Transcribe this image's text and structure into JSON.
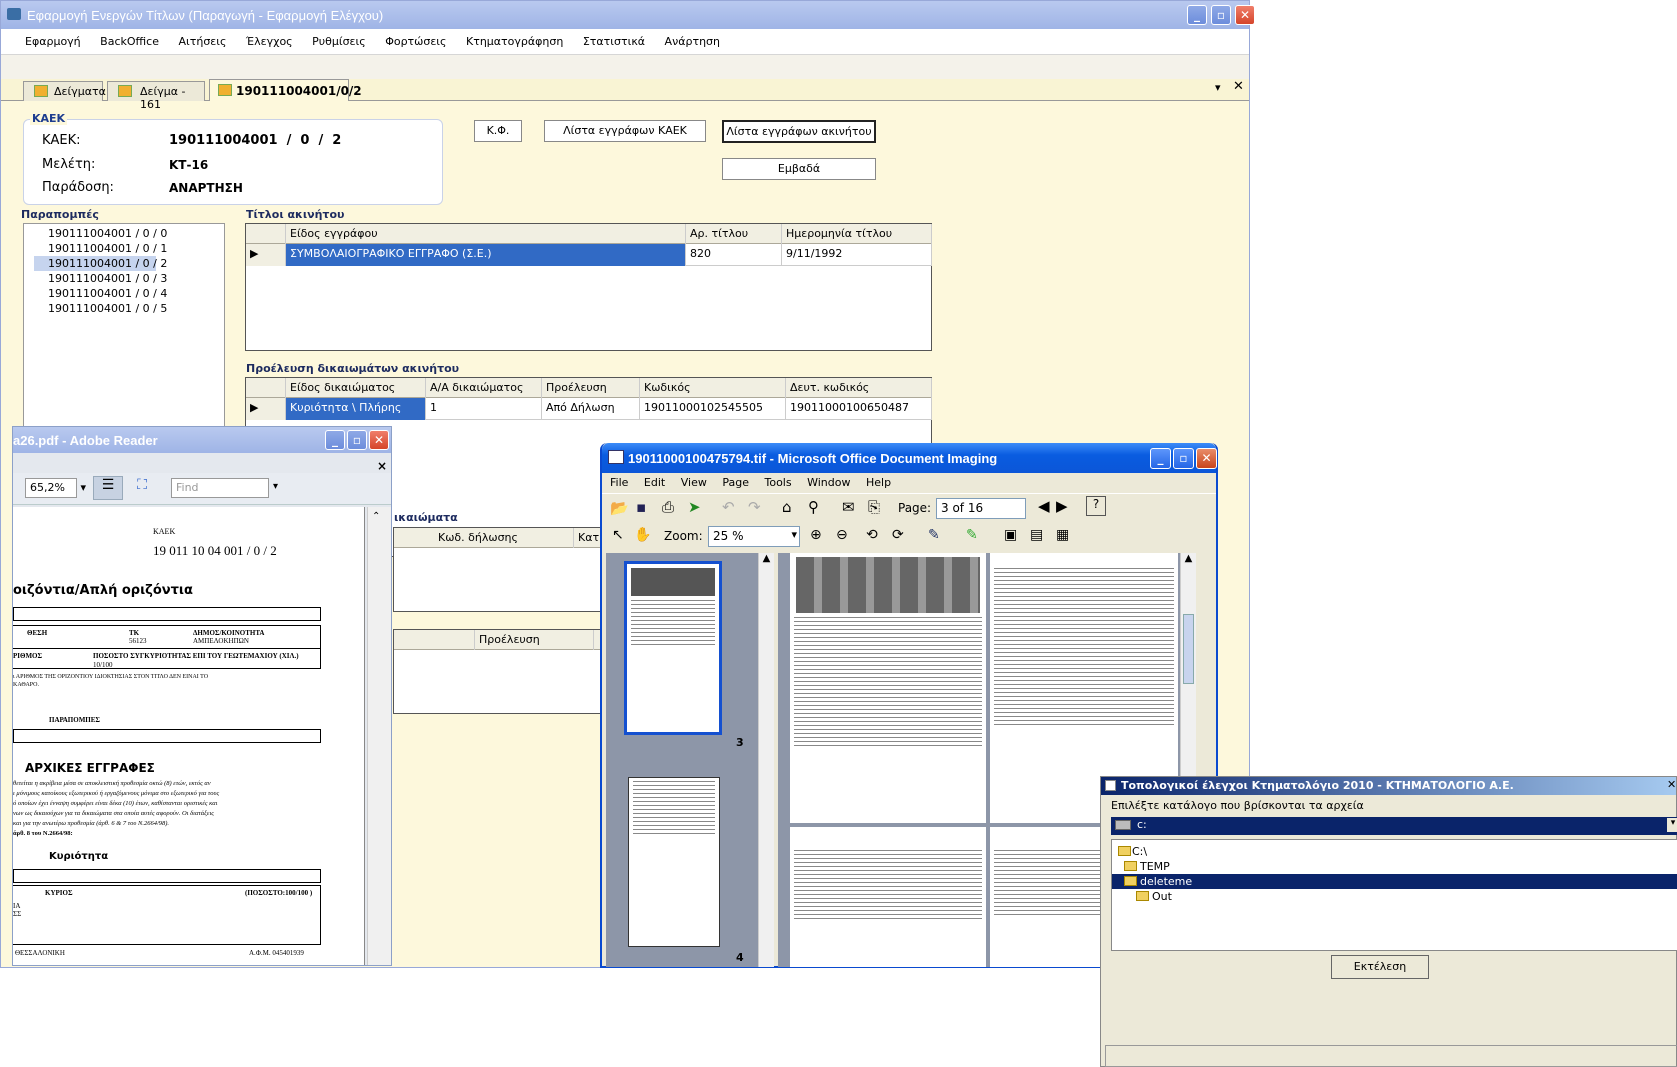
{
  "main_window": {
    "title": "Εφαρμογή Ενεργών Τίτλων (Παραγωγή - Εφαρμογή Ελέγχου)",
    "menu": [
      "Εφαρμογή",
      "BackOffice",
      "Αιτήσεις",
      "Έλεγχος",
      "Ρυθμίσεις",
      "Φορτώσεις",
      "Κτηματογράφηση",
      "Στατιστικά",
      "Ανάρτηση"
    ],
    "tabs": [
      "Δείγματα",
      "Δείγμα - 161",
      "190111004001/0/2"
    ],
    "kaek_group": {
      "label": "ΚΑΕΚ",
      "kaek_label": "ΚΑΕΚ:",
      "kaek_value": "190111004001  /  0  /  2",
      "study_label": "Μελέτη:",
      "study_value": "ΚΤ-16",
      "delivery_label": "Παράδοση:",
      "delivery_value": "ΑΝΑΡΤΗΣΗ"
    },
    "buttons": {
      "kf": "Κ.Φ.",
      "docs_kaek": "Λίστα εγγράφων ΚΑΕΚ",
      "docs_property": "Λίστα εγγράφων ακινήτου",
      "areas": "Εμβαδά"
    },
    "parapompes": {
      "label": "Παραπομπές",
      "items": [
        "190111004001 / 0 / 0",
        "190111004001 / 0 / 1",
        "190111004001 / 0 / 2",
        "190111004001 / 0 / 3",
        "190111004001 / 0 / 4",
        "190111004001 / 0 / 5"
      ],
      "selected": 2
    },
    "titles": {
      "label": "Τίτλοι ακινήτου",
      "headers": [
        "Είδος εγγράφου",
        "Αρ. τίτλου",
        "Ημερομηνία τίτλου"
      ],
      "rows": [
        [
          "ΣΥΜΒΟΛΑΙΟΓΡΑΦΙΚΟ ΕΓΓΡΑΦΟ (Σ.Ε.)",
          "820",
          "9/11/1992"
        ]
      ]
    },
    "rights": {
      "label": "Προέλευση δικαιωμάτων ακινήτου",
      "headers": [
        "Είδος δικαιώματος",
        "Α/Α δικαιώματος",
        "Προέλευση",
        "Κωδικός",
        "Δευτ. κωδικός"
      ],
      "rows": [
        [
          "Κυριότητα \\ Πλήρης",
          "1",
          "Από Δήλωση",
          "19011000102545505",
          "19011000100650487"
        ]
      ]
    },
    "rights2": {
      "label": "ικαιώματα",
      "headers": [
        "Κωδ. δήλωσης",
        "Κατ"
      ]
    },
    "rights3": {
      "header": "Προέλευση"
    }
  },
  "pdf_window": {
    "title": "a26.pdf - Adobe Reader",
    "zoom": "65,2%",
    "find_placeholder": "Find",
    "doc": {
      "kaek_label": "ΚΑΕΚ",
      "kaek_value": "19 011 10 04 001 / 0 / 2",
      "section1": "οιζόντια/Απλή οριζόντια",
      "col_thesi": "ΘΕΣΗ",
      "col_tk": "ΤΚ",
      "tk_value": "56123",
      "col_dimos": "ΔΗΜΟΣ/ΚΟΙΝΟΤΗΤΑ",
      "dimos_value": "ΑΜΠΕΛΟΚΗΠΩΝ",
      "col_arithmos": "ΡΙΘΜΟΣ",
      "col_pososto": "ΠΟΣΟΣΤΟ ΣΥΓΚΥΡΙΟΤΗΤΑΣ ΕΠΙ ΤΟΥ ΓΕΩΤΕΜΑΧΙΟΥ (ΧΙΛ.)",
      "pososto_value": "10/100",
      "note": "ι ΑΡΙΘΜΟΣ ΤΗΣ ΟΡΙΖΟΝΤΙΟΥ ΙΔΙΟΚΤΗΣΙΑΣ ΣΤΟΝ ΤΙΤΛΟ ΔΕΝ ΕΙΝΑΙ ΤΟ ΚΑΘΑΡΟ.",
      "parapompes": "ΠΑΡΑΠΟΜΠΕΣ",
      "initial": "ΑΡΧΙΚΕΣ ΕΓΓΡΑΦΕΣ",
      "para1": "θετείται η ακρίβεια μέσα σε αποκλειστική προθεσμία οκτώ (8) ετών, εκτός αν",
      "para2": "ι μόνιμους κατοίκους εξωτερικού ή εργαζόμενους μόνιμα στο εξωτερικό για τους",
      "para3": "ό οποίων έχει ένναψη συμφέρει είναι δέκα (10) έτων, καθίστανται οριστικές και",
      "para4": "νων ως δικαιούχων για τα δικαιώματα στα οποία αυτές αφορούν. Οι διατάξεις",
      "para5": "και για την ανωτέρω προθεσμία (άρθ. 6 & 7 του Ν.2664/98).",
      "para6": "άρθ. 8 του Ν.2664/98:",
      "kyriotita": "Κυριότητα",
      "col_kyrios": "ΚΥΡΙΟΣ",
      "col_pososto2": "(ΠΟΣΟΣΤΟ:100/100 )",
      "city": "ΘΕΣΣΑΛΟΝΙΚΗ",
      "afm": "Α.Φ.Μ. 045401939"
    }
  },
  "imaging_window": {
    "title": "19011000100475794.tif - Microsoft Office Document Imaging",
    "menu": [
      "File",
      "Edit",
      "View",
      "Page",
      "Tools",
      "Window",
      "Help"
    ],
    "page_label": "Page:",
    "page_value": "3 of 16",
    "zoom_label": "Zoom:",
    "zoom_value": "25 %",
    "thumbs": [
      "3",
      "4"
    ]
  },
  "topo_window": {
    "title": "Τοπολογικοί έλεγχοι Κτηματολόγιο 2010 - ΚΤΗΜΑΤΟΛΟΓΙΟ Α.Ε.",
    "prompt": "Επιλέξτε κατάλογο που βρίσκονται τα αρχεία",
    "drive": "c:",
    "tree": [
      "C:\\",
      "TEMP",
      "deleteme",
      "Out"
    ],
    "selected": 2,
    "run": "Εκτέλεση"
  }
}
